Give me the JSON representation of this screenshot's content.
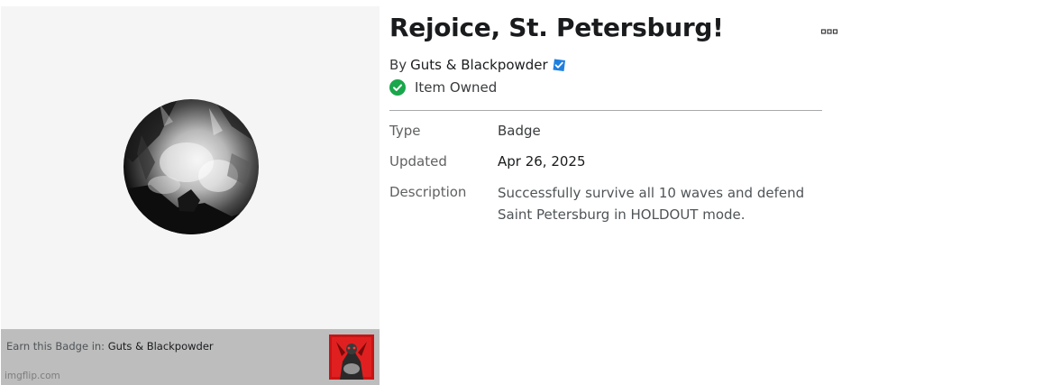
{
  "badge": {
    "title": "Rejoice, St. Petersburg!",
    "by_prefix": "By",
    "creator": "Guts & Blackpowder",
    "verified_icon": "verified-badge-icon",
    "owned_label": "Item Owned",
    "owned_icon": "checkmark-circle-icon",
    "more_icon": "ellipsis-icon"
  },
  "details": {
    "type_label": "Type",
    "type_value": "Badge",
    "updated_label": "Updated",
    "updated_value": "Apr 26, 2025",
    "description_label": "Description",
    "description_value": "Successfully survive all 10 waves and defend Saint Petersburg in HOLDOUT mode."
  },
  "earn": {
    "prefix": "Earn this Badge in:",
    "game": "Guts & Blackpowder"
  },
  "watermark": "imgflip.com",
  "colors": {
    "owned_green": "#1aa64b",
    "verified_blue": "#1f7fe0",
    "panel_bg": "#f5f5f5",
    "earn_bar_bg": "#bdbdbd"
  }
}
